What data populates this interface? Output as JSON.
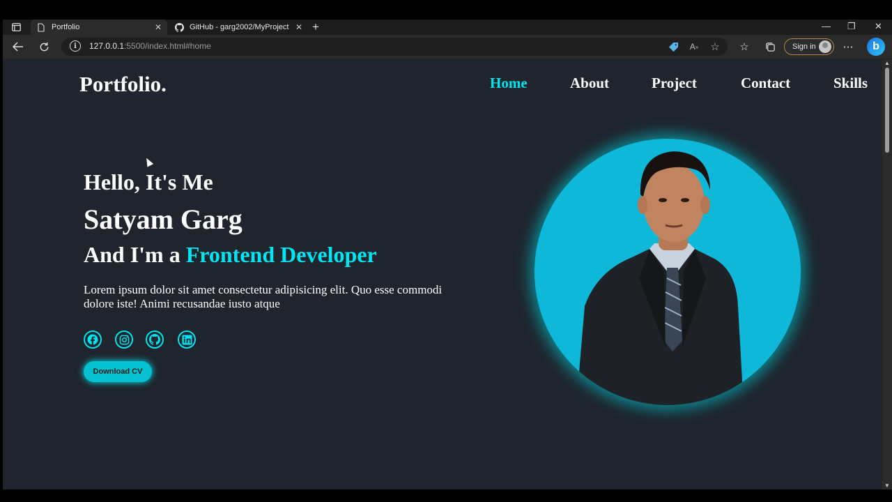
{
  "browser": {
    "tabs": [
      {
        "title": "Portfolio",
        "active": true
      },
      {
        "title": "GitHub - garg2002/MyProject",
        "active": false
      }
    ],
    "url_main": "127.0.0.1",
    "url_rest": ":5500/index.html#home",
    "signin_label": "Sign in",
    "bing_label": "b"
  },
  "site": {
    "logo": "Portfolio.",
    "nav": [
      {
        "label": "Home",
        "active": true
      },
      {
        "label": "About",
        "active": false
      },
      {
        "label": "Project",
        "active": false
      },
      {
        "label": "Contact",
        "active": false
      },
      {
        "label": "Skills",
        "active": false
      }
    ],
    "greeting": "Hello, It's Me",
    "name": "Satyam Garg",
    "role_prefix": "And I'm a ",
    "role": "Frontend Developer",
    "description": "Lorem ipsum dolor sit amet consectetur adipisicing elit. Quo esse commodi dolore iste! Animi recusandae iusto atque",
    "social": [
      "facebook-icon",
      "instagram-icon",
      "github-icon",
      "linkedin-icon"
    ],
    "cv_button": "Download CV"
  },
  "colors": {
    "accent": "#00e5f0",
    "page_bg": "#1f242d",
    "photo_bg": "#0fb8d8"
  }
}
